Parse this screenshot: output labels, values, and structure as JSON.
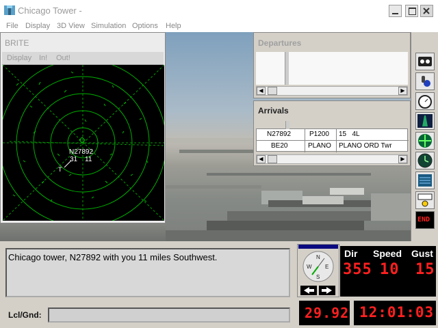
{
  "window": {
    "title": "Chicago Tower -"
  },
  "menu": [
    "File",
    "Display",
    "3D View",
    "Simulation",
    "Options",
    "Help"
  ],
  "brite": {
    "title": "BRITE",
    "menu": [
      "Display",
      "In!",
      "Out!"
    ],
    "target": {
      "callsign": "N27892",
      "altitude": "31",
      "speed": "11"
    }
  },
  "departures": {
    "title": "Departures"
  },
  "arrivals": {
    "title": "Arrivals",
    "rows": [
      {
        "callsign": "N27892",
        "type": "P1200",
        "info": "15   4L"
      },
      {
        "callsign": "BE20",
        "type": "PLANO",
        "info": "PLANO ORD Twr"
      }
    ]
  },
  "toolbar": [
    "cassette-icon",
    "microphone-icon",
    "stopwatch-icon",
    "runway-icon",
    "compass-rose-icon",
    "clock-icon",
    "screen-icon",
    "map-icon",
    "end-button"
  ],
  "toolbar_end_label": "END",
  "message": {
    "text": "Chicago tower, N27892 with you 11 miles Southwest."
  },
  "input": {
    "label": "Lcl/Gnd:",
    "value": ""
  },
  "compass": {
    "n": "N",
    "e": "E",
    "s": "S",
    "w": "W"
  },
  "wind": {
    "dir_label": "Dir",
    "speed_label": "Speed",
    "gust_label": "Gust",
    "dir": "355",
    "speed": "10",
    "gust": "15"
  },
  "altimeter": "29.92",
  "clock": "12:01:03",
  "colors": {
    "led": "#ff2020",
    "radar": "#00c000",
    "radar_bg": "#000000"
  }
}
